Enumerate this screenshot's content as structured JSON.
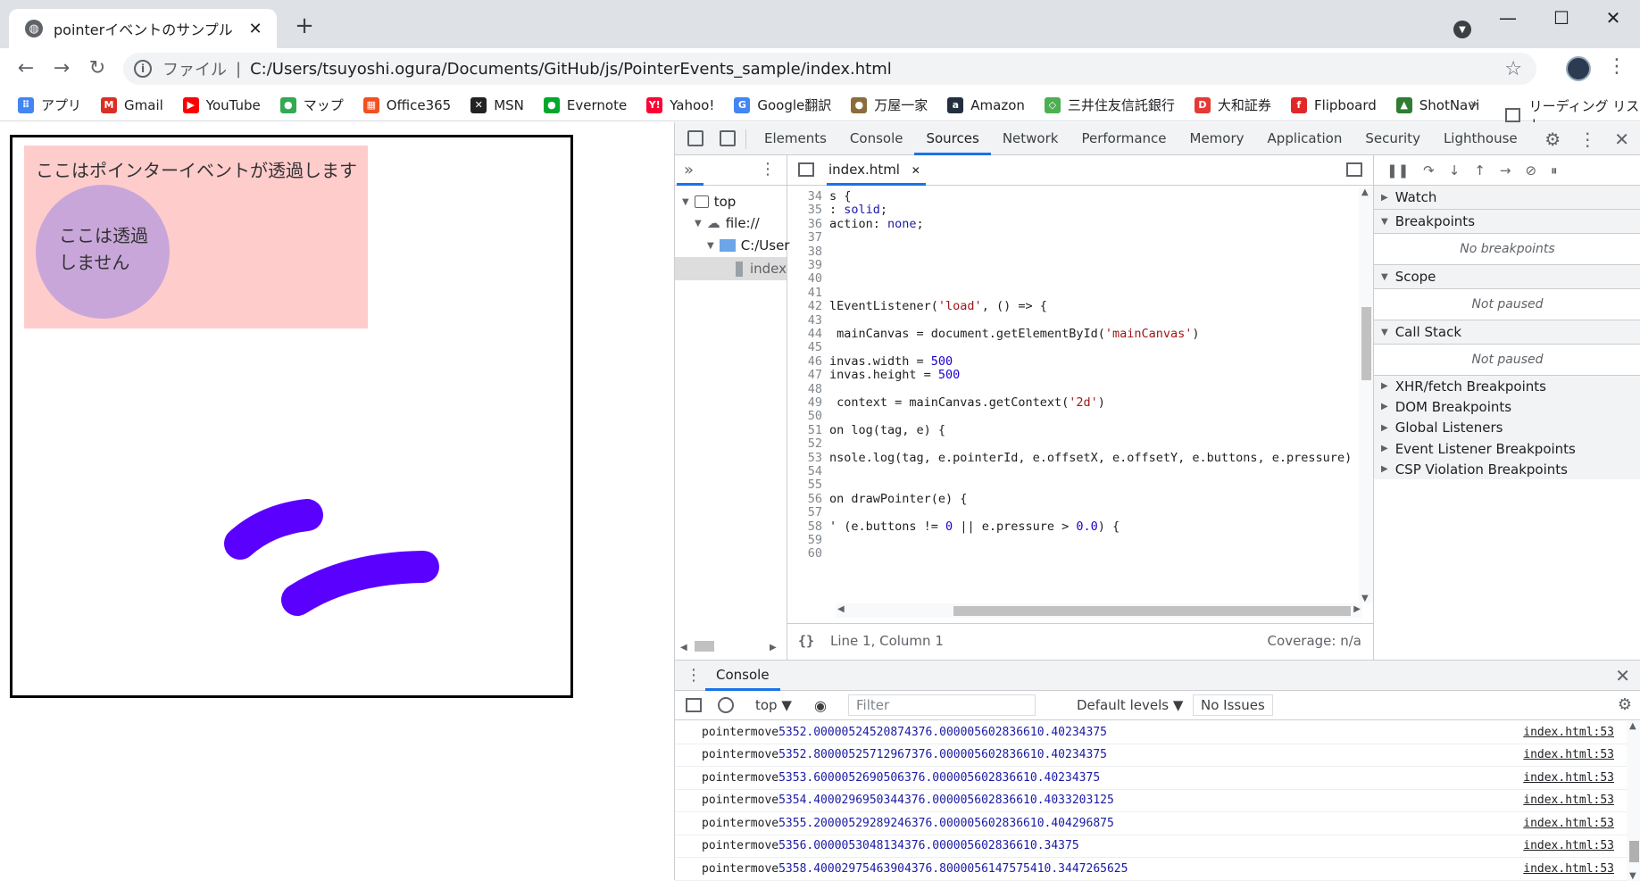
{
  "browser": {
    "tab_title": "pointerイベントのサンプル",
    "tab_close": "✕",
    "new_tab": "+",
    "window_controls": [
      "—",
      "☐",
      "✕"
    ]
  },
  "address_bar": {
    "scheme_label": "ファイル",
    "separator": "|",
    "url": "C:/Users/tsuyoshi.ogura/Documents/GitHub/js/PointerEvents_sample/index.html"
  },
  "bookmarks": [
    {
      "label": "アプリ",
      "icon": "apps-grid-icon",
      "color": "#4285f4",
      "glyph": "⠿"
    },
    {
      "label": "Gmail",
      "icon": "gmail-icon",
      "color": "#d93025",
      "glyph": "M"
    },
    {
      "label": "YouTube",
      "icon": "youtube-icon",
      "color": "#ff0000",
      "glyph": "▶"
    },
    {
      "label": "マップ",
      "icon": "maps-pin-icon",
      "color": "#34a853",
      "glyph": "●"
    },
    {
      "label": "Office365",
      "icon": "office365-icon",
      "color": "#f25022",
      "glyph": "▦"
    },
    {
      "label": "MSN",
      "icon": "msn-icon",
      "color": "#222222",
      "glyph": "✕"
    },
    {
      "label": "Evernote",
      "icon": "evernote-icon",
      "color": "#00a82d",
      "glyph": "●"
    },
    {
      "label": "Yahoo!",
      "icon": "yahoo-icon",
      "color": "#ff0033",
      "glyph": "Y!"
    },
    {
      "label": "Google翻訳",
      "icon": "google-translate-icon",
      "color": "#4285f4",
      "glyph": "G"
    },
    {
      "label": "万屋一家",
      "icon": "yorozuya-icon",
      "color": "#8a6d3b",
      "glyph": "●"
    },
    {
      "label": "Amazon",
      "icon": "amazon-icon",
      "color": "#232f3e",
      "glyph": "a"
    },
    {
      "label": "三井住友信託銀行",
      "icon": "smtb-icon",
      "color": "#4caf50",
      "glyph": "◇"
    },
    {
      "label": "大和証券",
      "icon": "daiwa-icon",
      "color": "#e53935",
      "glyph": "D"
    },
    {
      "label": "Flipboard",
      "icon": "flipboard-icon",
      "color": "#e12828",
      "glyph": "f"
    },
    {
      "label": "ShotNavi",
      "icon": "shotnavi-icon",
      "color": "#2e7d32",
      "glyph": "▲"
    }
  ],
  "bookmarks_more": "»",
  "reading_list": "リーディング リスト",
  "page": {
    "pink_text": "ここはポインターイベントが透過します",
    "circle_line1": "ここは透過",
    "circle_line2": "しません"
  },
  "devtools": {
    "tabs": [
      "Elements",
      "Console",
      "Sources",
      "Network",
      "Performance",
      "Memory",
      "Application",
      "Security",
      "Lighthouse"
    ],
    "active_tab": "Sources",
    "navigator": {
      "top": "top",
      "origin": "file://",
      "folder": "C:/User",
      "file": "index"
    },
    "editor_file": "index.html",
    "editor_file_close": "✕",
    "status_brace": "{}",
    "status_position": "Line 1, Column 1",
    "status_coverage": "Coverage: n/a",
    "debugger": {
      "watch": "Watch",
      "breakpoints": "Breakpoints",
      "no_breakpoints": "No breakpoints",
      "scope": "Scope",
      "scope_status": "Not paused",
      "call_stack": "Call Stack",
      "call_stack_status": "Not paused",
      "other_panes": [
        "XHR/fetch Breakpoints",
        "DOM Breakpoints",
        "Global Listeners",
        "Event Listener Breakpoints",
        "CSP Violation Breakpoints"
      ]
    },
    "drawer_tab": "Console",
    "console": {
      "context": "top ▼",
      "filter_placeholder": "Filter",
      "levels": "Default levels ▼",
      "issues": "No Issues",
      "rows": [
        {
          "tag": "pointermove",
          "id": "5",
          "x": "352.00000524520874",
          "y": "376.0000056028366",
          "buttons": "1",
          "pressure": "0.40234375",
          "source": "index.html:53"
        },
        {
          "tag": "pointermove",
          "id": "5",
          "x": "352.80000525712967",
          "y": "376.0000056028366",
          "buttons": "1",
          "pressure": "0.40234375",
          "source": "index.html:53"
        },
        {
          "tag": "pointermove",
          "id": "5",
          "x": "353.6000052690506",
          "y": "376.0000056028366",
          "buttons": "1",
          "pressure": "0.40234375",
          "source": "index.html:53"
        },
        {
          "tag": "pointermove",
          "id": "5",
          "x": "354.4000296950344",
          "y": "376.0000056028366",
          "buttons": "1",
          "pressure": "0.4033203125",
          "source": "index.html:53"
        },
        {
          "tag": "pointermove",
          "id": "5",
          "x": "355.20000529289246",
          "y": "376.0000056028366",
          "buttons": "1",
          "pressure": "0.404296875",
          "source": "index.html:53"
        },
        {
          "tag": "pointermove",
          "id": "5",
          "x": "356.0000053048134",
          "y": "376.0000056028366",
          "buttons": "1",
          "pressure": "0.34375",
          "source": "index.html:53"
        },
        {
          "tag": "pointermove",
          "id": "5",
          "x": "358.40002975463904",
          "y": "376.80000561475754",
          "buttons": "1",
          "pressure": "0.3447265625",
          "source": "index.html:53"
        }
      ]
    },
    "code_lines": [
      {
        "n": "34",
        "html": "s {"
      },
      {
        "n": "35",
        "html": ": <span class='val'>solid</span>;"
      },
      {
        "n": "36",
        "html": "action: <span class='val'>none</span>;"
      },
      {
        "n": "37",
        "html": ""
      },
      {
        "n": "38",
        "html": ""
      },
      {
        "n": "39",
        "html": ""
      },
      {
        "n": "40",
        "html": ""
      },
      {
        "n": "41",
        "html": ""
      },
      {
        "n": "42",
        "html": "lEventListener(<span class='str'>'load'</span>, () => {"
      },
      {
        "n": "43",
        "html": ""
      },
      {
        "n": "44",
        "html": " mainCanvas = document.getElementById(<span class='str'>'mainCanvas'</span>)"
      },
      {
        "n": "45",
        "html": ""
      },
      {
        "n": "46",
        "html": "invas.width = <span class='num'>500</span>"
      },
      {
        "n": "47",
        "html": "invas.height = <span class='num'>500</span>"
      },
      {
        "n": "48",
        "html": ""
      },
      {
        "n": "49",
        "html": " context = mainCanvas.getContext(<span class='str'>'2d'</span>)"
      },
      {
        "n": "50",
        "html": ""
      },
      {
        "n": "51",
        "html": "on log(tag, e) {"
      },
      {
        "n": "52",
        "html": ""
      },
      {
        "n": "53",
        "html": "nsole.log(tag, e.pointerId, e.offsetX, e.offsetY, e.buttons, e.pressure)"
      },
      {
        "n": "54",
        "html": ""
      },
      {
        "n": "55",
        "html": ""
      },
      {
        "n": "56",
        "html": "on drawPointer(e) {"
      },
      {
        "n": "57",
        "html": ""
      },
      {
        "n": "58",
        "html": "' (e.buttons != <span class='num'>0</span> || e.pressure > <span class='num'>0.0</span>) {"
      },
      {
        "n": "59",
        "html": ""
      },
      {
        "n": "60",
        "html": ""
      }
    ]
  }
}
